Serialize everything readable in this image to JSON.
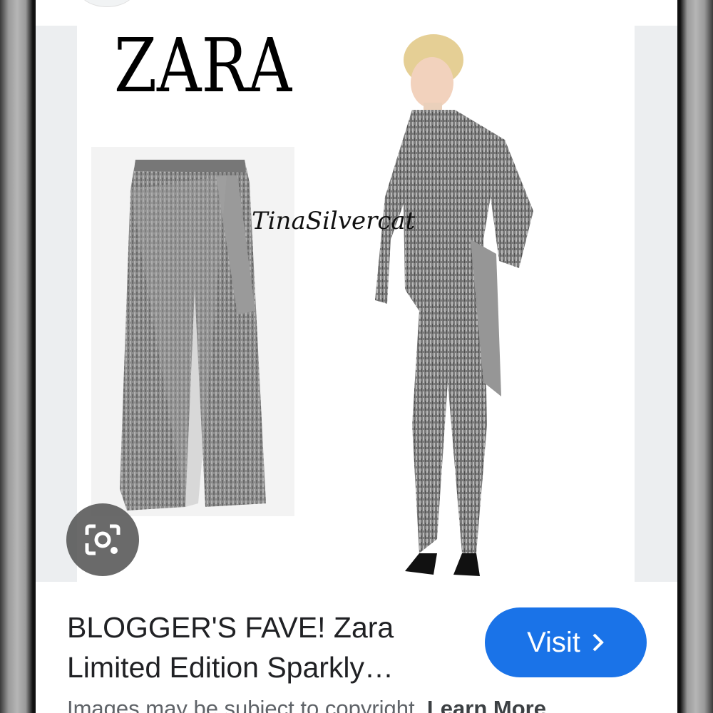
{
  "image": {
    "brand_logo_text": "ZARA",
    "watermark_text": "TinaSilvercat",
    "lens_icon": "google-lens-icon"
  },
  "result": {
    "title": "BLOGGER'S FAVE! Zara Limited Edition Sparkly…",
    "visit_label": "Visit",
    "visit_icon": "chevron-right-icon",
    "copyright_text": "Images may be subject to copyright.",
    "learn_more_label": "Learn More"
  },
  "colors": {
    "accent": "#1a73e8",
    "title_text": "#202124",
    "secondary_text": "#5f6368"
  }
}
